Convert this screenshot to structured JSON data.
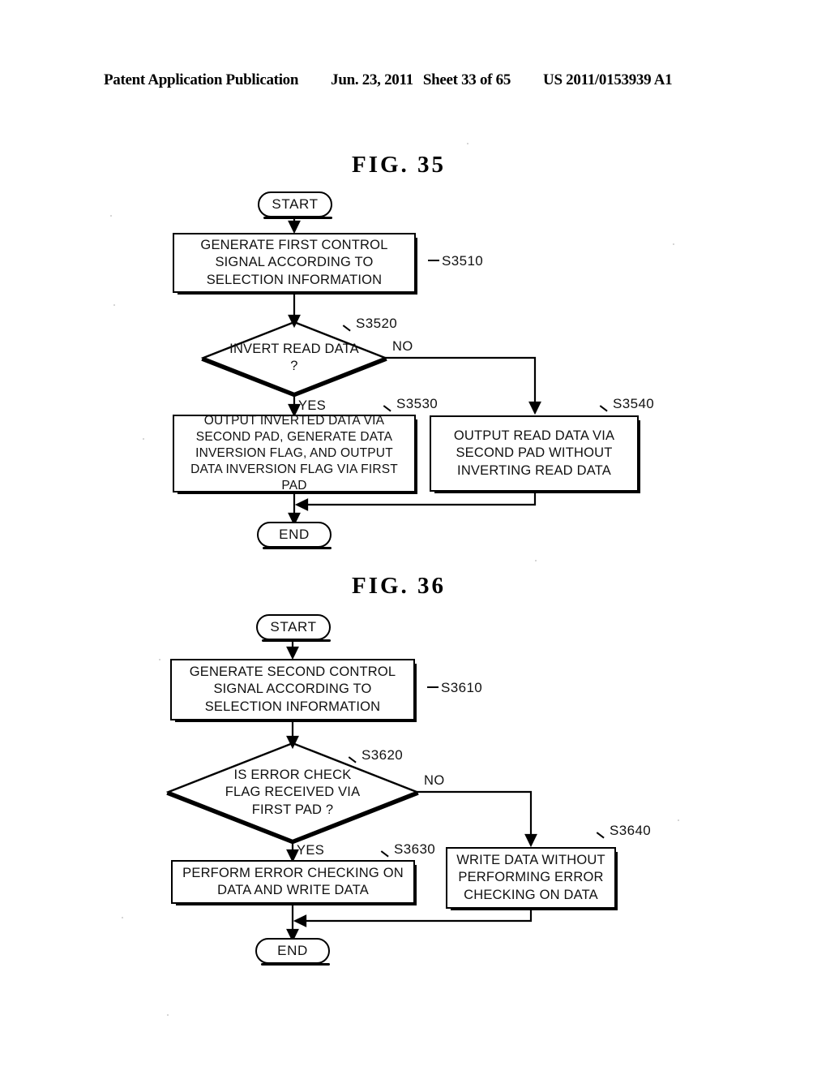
{
  "header": {
    "publication": "Patent Application Publication",
    "date": "Jun. 23, 2011",
    "sheet": "Sheet 33 of 65",
    "publication_number": "US 2011/0153939 A1"
  },
  "figures": [
    {
      "id": "fig35",
      "title": "FIG.  35",
      "nodes": {
        "start": "START",
        "end": "END",
        "step1": "GENERATE FIRST CONTROL SIGNAL ACCORDING TO SELECTION INFORMATION",
        "decision": "INVERT READ DATA ?",
        "yes_step": "OUTPUT INVERTED DATA VIA SECOND PAD, GENERATE DATA INVERSION FLAG, AND OUTPUT DATA INVERSION FLAG VIA FIRST PAD",
        "no_step": "OUTPUT READ DATA VIA SECOND PAD WITHOUT INVERTING READ DATA"
      },
      "refs": {
        "step1": "S3510",
        "decision": "S3520",
        "yes_step": "S3530",
        "no_step": "S3540"
      },
      "branches": {
        "yes": "YES",
        "no": "NO"
      }
    },
    {
      "id": "fig36",
      "title": "FIG.  36",
      "nodes": {
        "start": "START",
        "end": "END",
        "step1": "GENERATE SECOND CONTROL SIGNAL ACCORDING TO SELECTION INFORMATION",
        "decision": "IS ERROR CHECK FLAG RECEIVED VIA FIRST PAD ?",
        "yes_step": "PERFORM ERROR CHECKING ON DATA AND WRITE DATA",
        "no_step": "WRITE DATA WITHOUT PERFORMING ERROR CHECKING ON DATA"
      },
      "refs": {
        "step1": "S3610",
        "decision": "S3620",
        "yes_step": "S3630",
        "no_step": "S3640"
      },
      "branches": {
        "yes": "YES",
        "no": "NO"
      }
    }
  ],
  "colors": {
    "ink": "#000000",
    "paper": "#ffffff"
  }
}
